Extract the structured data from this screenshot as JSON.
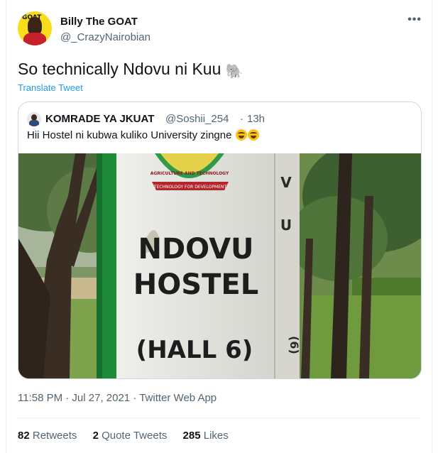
{
  "tweet": {
    "author_name": "Billy The GOAT",
    "author_handle": "@_CrazyNairobian",
    "text": "So technically Ndovu ni Kuu",
    "text_emoji": "elephant-icon",
    "translate_label": "Translate Tweet",
    "more_icon": "more-icon",
    "timestamp": "11:58 PM · Jul 27, 2021 · Twitter Web App"
  },
  "quoted_tweet": {
    "author_name": "KOMRADE YA JKUAT",
    "author_handle": "@Soshii_254",
    "separator": "·",
    "time": "13h",
    "text": "Hii Hostel ni kubwa kuliko University zingne",
    "text_emoji": "laughing-icon",
    "image": {
      "sign_line1": "NDOVU",
      "sign_line2": "HOSTEL",
      "sign_line3": "(HALL 6)",
      "logo_top_text": "AGRICULTURE AND TECHNOLOGY",
      "logo_banner_text": "TECHNOLOGY FOR DEVELOPMENT",
      "side_letter_1": "V",
      "side_letter_2": "U",
      "side_text": "(6)"
    }
  },
  "stats": {
    "retweets_count": "82",
    "retweets_label": "Retweets",
    "quotes_count": "2",
    "quotes_label": "Quote Tweets",
    "likes_count": "285",
    "likes_label": "Likes"
  },
  "colors": {
    "link": "#1d9bf0",
    "secondary_text": "#536471",
    "border": "#cfd9de"
  }
}
